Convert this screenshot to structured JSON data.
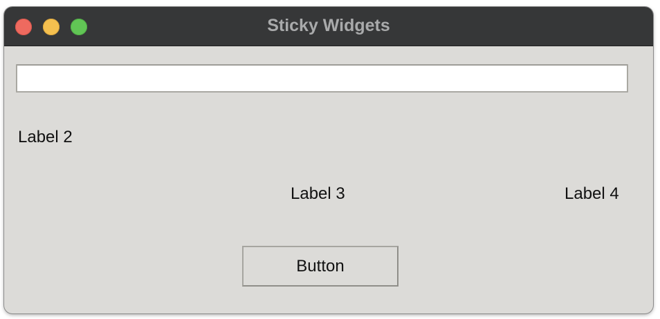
{
  "window": {
    "title": "Sticky Widgets",
    "controls": [
      "close",
      "minimize",
      "zoom"
    ]
  },
  "entry": {
    "value": "",
    "placeholder": ""
  },
  "labels": {
    "label2": "Label 2",
    "label3": "Label 3",
    "label4": "Label 4"
  },
  "button": {
    "label": "Button"
  },
  "colors": {
    "titlebar": "#363738",
    "window_bg": "#dcdbd8",
    "close": "#ee6a5f",
    "minimize": "#f5c04f",
    "zoom": "#61c555"
  }
}
